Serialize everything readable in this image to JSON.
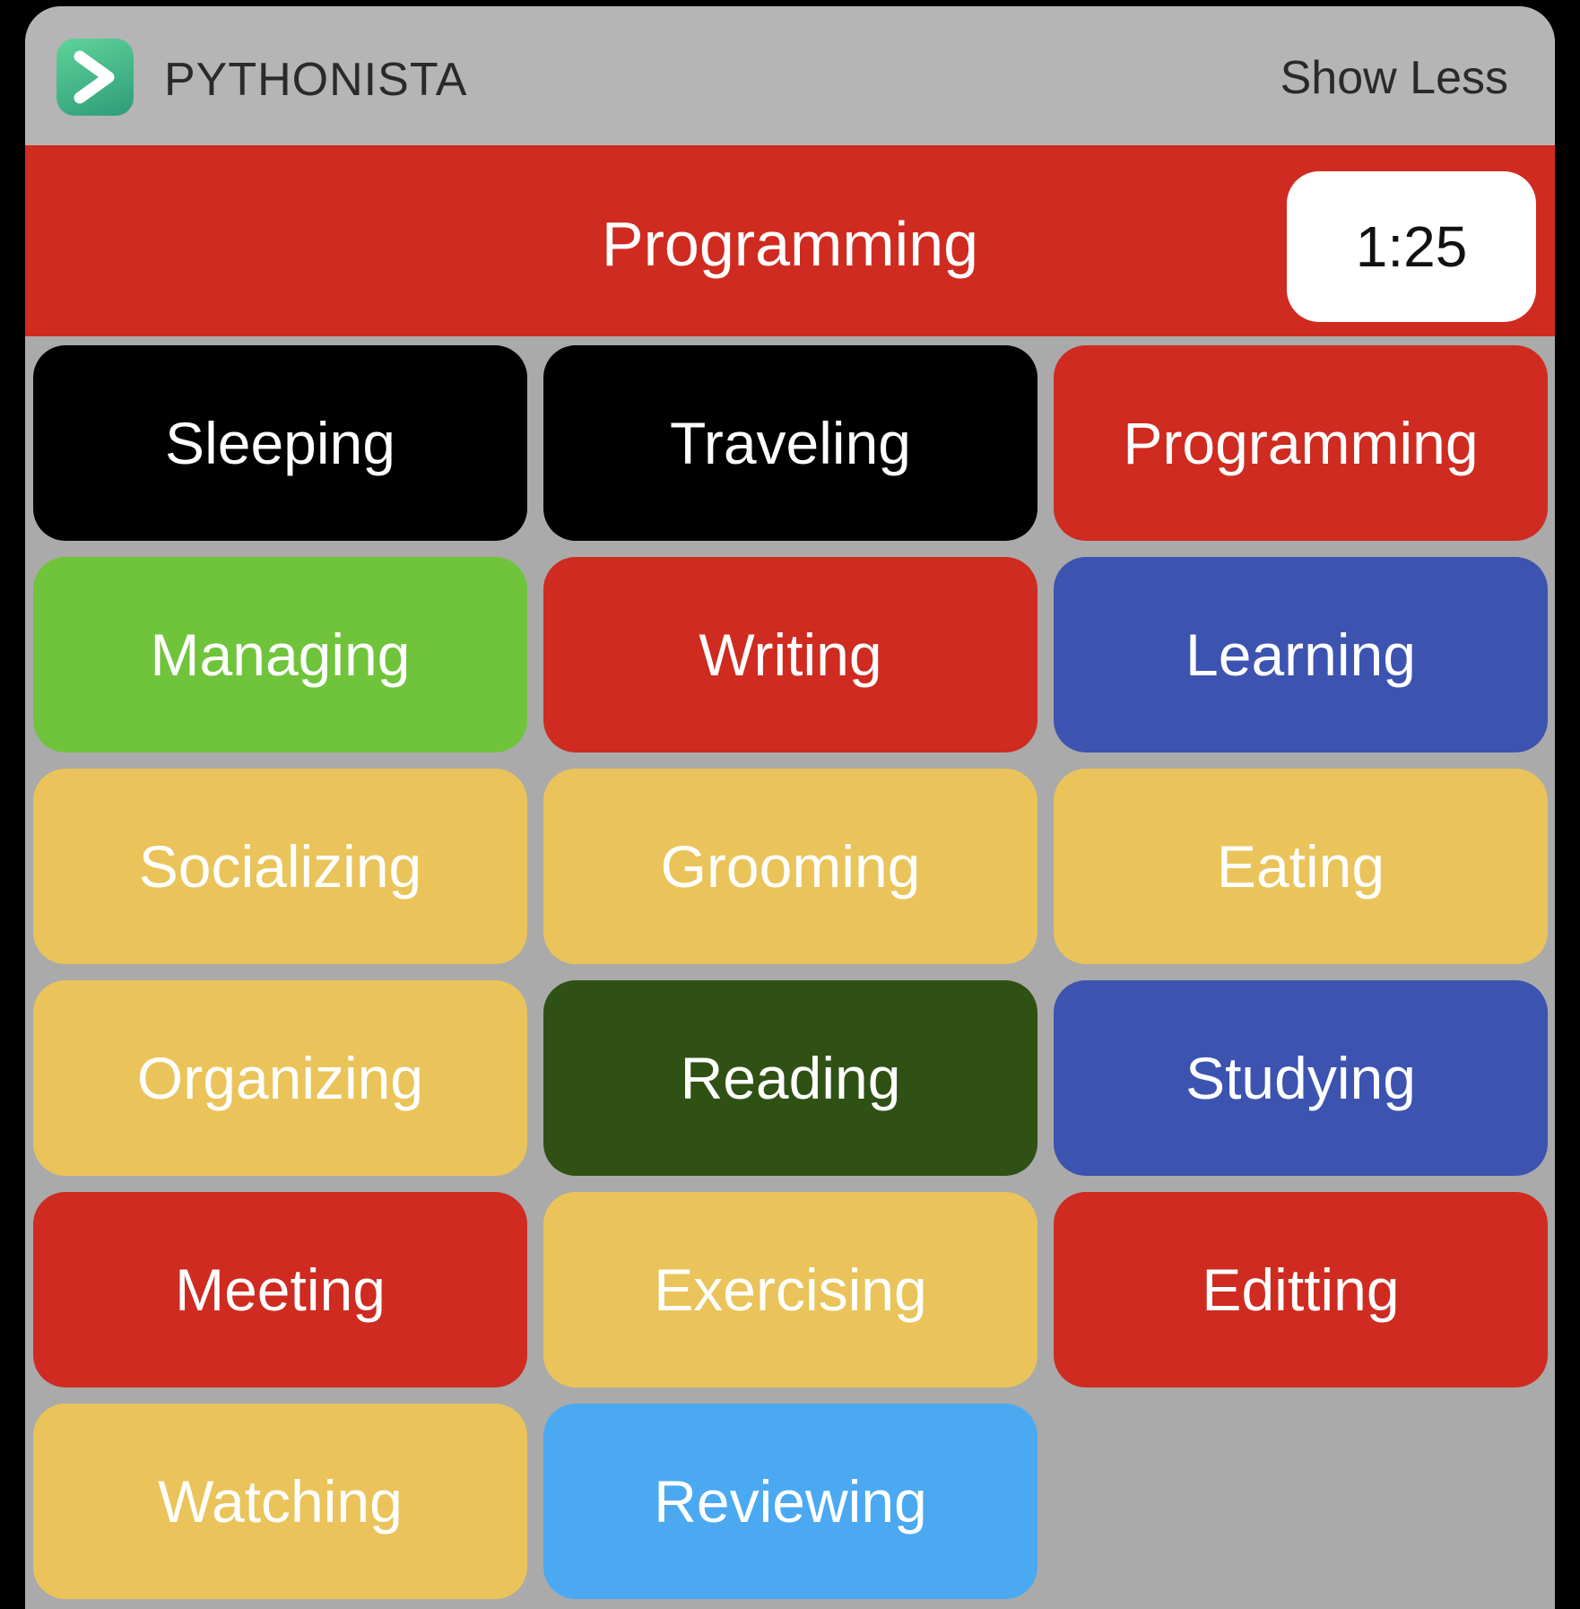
{
  "header": {
    "app_name": "PYTHONISTA",
    "show_less_label": "Show Less",
    "icon": "pythonista-app-icon"
  },
  "current": {
    "label": "Programming",
    "timer": "1:25",
    "color": "#cf2b20"
  },
  "activities": [
    {
      "label": "Sleeping",
      "color": "#000000"
    },
    {
      "label": "Traveling",
      "color": "#000000"
    },
    {
      "label": "Programming",
      "color": "#cf2b20"
    },
    {
      "label": "Managing",
      "color": "#70c43b"
    },
    {
      "label": "Writing",
      "color": "#cf2b20"
    },
    {
      "label": "Learning",
      "color": "#3c53b0"
    },
    {
      "label": "Socializing",
      "color": "#eac45a"
    },
    {
      "label": "Grooming",
      "color": "#eac45a"
    },
    {
      "label": "Eating",
      "color": "#eac45a"
    },
    {
      "label": "Organizing",
      "color": "#eac45a"
    },
    {
      "label": "Reading",
      "color": "#2f5214"
    },
    {
      "label": "Studying",
      "color": "#3c53b0"
    },
    {
      "label": "Meeting",
      "color": "#cf2b20"
    },
    {
      "label": "Exercising",
      "color": "#eac45a"
    },
    {
      "label": "Editting",
      "color": "#cf2b20"
    },
    {
      "label": "Watching",
      "color": "#eac45a"
    },
    {
      "label": "Reviewing",
      "color": "#4aa9f1"
    }
  ]
}
